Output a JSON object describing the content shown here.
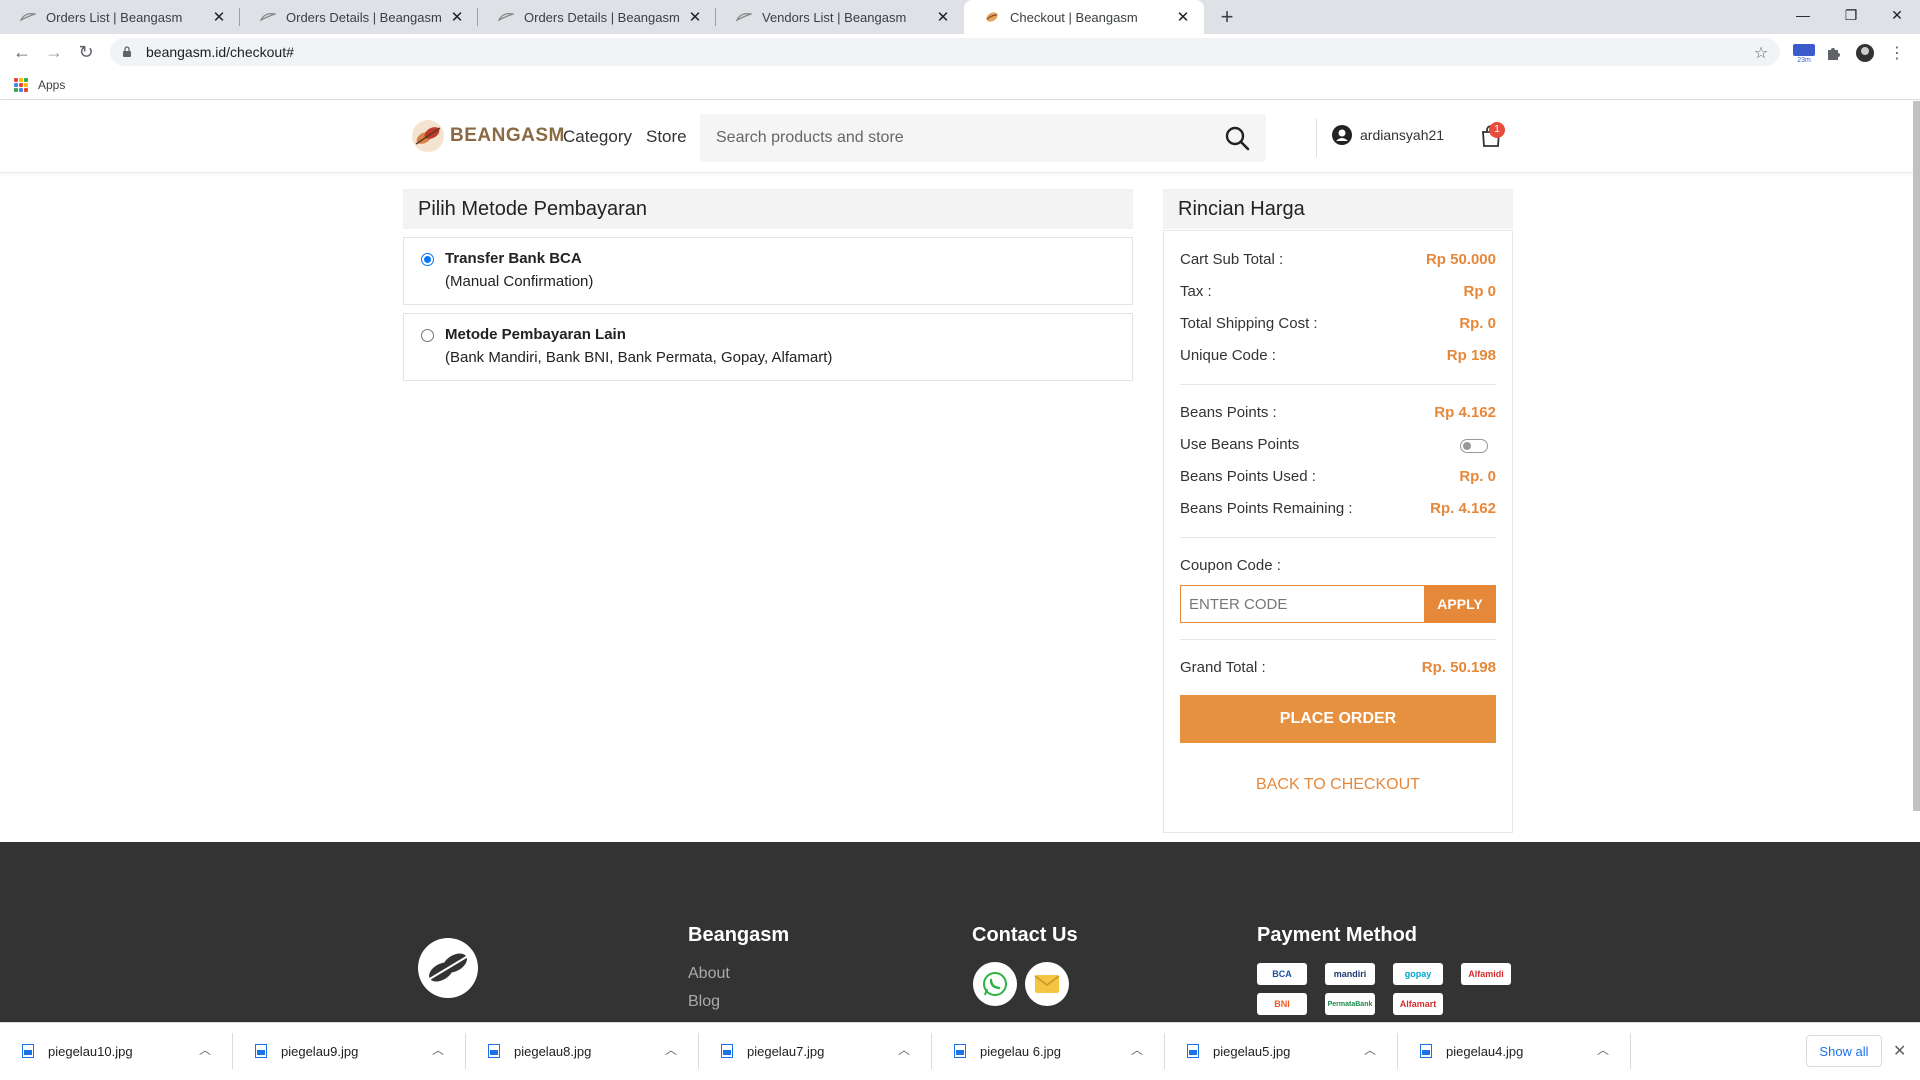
{
  "browser": {
    "tabs": [
      {
        "title": "Orders List | Beangasm",
        "active": false
      },
      {
        "title": "Orders Details | Beangasm",
        "active": false
      },
      {
        "title": "Orders Details | Beangasm",
        "active": false
      },
      {
        "title": "Vendors List | Beangasm",
        "active": false
      },
      {
        "title": "Checkout | Beangasm",
        "active": true
      }
    ],
    "url": "beangasm.id/checkout#",
    "bookmarks_apps_label": "Apps",
    "extension_badge": "23m"
  },
  "header": {
    "brand": "BEANGASM",
    "nav": [
      "Category",
      "Store"
    ],
    "search_placeholder": "Search products and store",
    "username": "ardiansyah21",
    "cart_count": "1"
  },
  "payment": {
    "title": "Pilih Metode Pembayaran",
    "options": [
      {
        "name": "Transfer Bank BCA",
        "desc": "(Manual Confirmation)",
        "selected": true
      },
      {
        "name": "Metode Pembayaran Lain",
        "desc": "(Bank Mandiri, Bank BNI, Bank Permata, Gopay, Alfamart)",
        "selected": false
      }
    ]
  },
  "summary": {
    "title": "Rincian Harga",
    "cart_sub_total_label": "Cart Sub Total :",
    "cart_sub_total": "Rp 50.000",
    "tax_label": "Tax :",
    "tax": "Rp 0",
    "shipping_label": "Total Shipping Cost :",
    "shipping": "Rp. 0",
    "unique_code_label": "Unique Code :",
    "unique_code": "Rp 198",
    "beans_points_label": "Beans Points :",
    "beans_points": "Rp 4.162",
    "use_beans_label": "Use Beans Points",
    "use_beans_on": false,
    "beans_used_label": "Beans Points Used :",
    "beans_used": "Rp. 0",
    "beans_remaining_label": "Beans Points Remaining :",
    "beans_remaining": "Rp. 4.162",
    "coupon_label": "Coupon Code :",
    "coupon_placeholder": "ENTER CODE",
    "apply_label": "APPLY",
    "grand_total_label": "Grand Total :",
    "grand_total": "Rp. 50.198",
    "place_order_label": "PLACE ORDER",
    "back_label": "BACK TO CHECKOUT"
  },
  "footer": {
    "brand_title": "Beangasm",
    "links": [
      "About",
      "Blog"
    ],
    "contact_title": "Contact Us",
    "payment_title": "Payment Method",
    "payment_logos": [
      "BCA",
      "mandiri",
      "gopay",
      "Alfamidi",
      "BNI",
      "PermataBank",
      "Alfamart"
    ]
  },
  "downloads": {
    "files": [
      "piegelau10.jpg",
      "piegelau9.jpg",
      "piegelau8.jpg",
      "piegelau7.jpg",
      "piegelau 6.jpg",
      "piegelau5.jpg",
      "piegelau4.jpg"
    ],
    "show_all_label": "Show all"
  },
  "colors": {
    "accent": "#e6883a",
    "footer_bg": "#333333",
    "radio_blue": "#0075ff",
    "badge_red": "#e74c3c"
  }
}
